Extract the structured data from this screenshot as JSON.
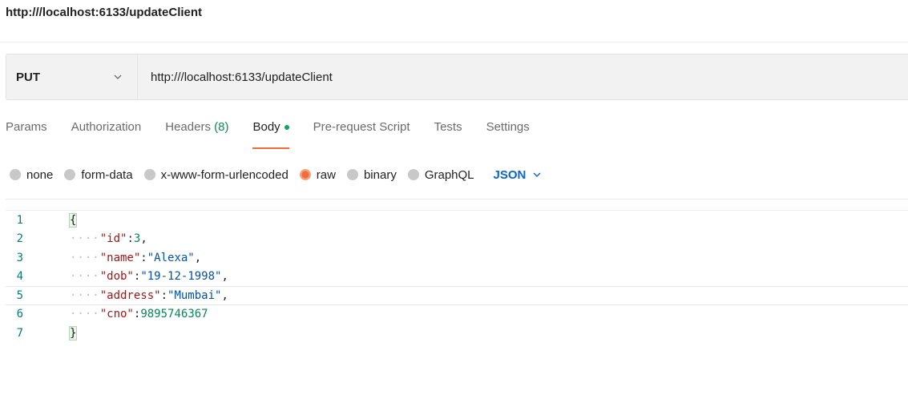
{
  "request": {
    "title": "http:///localhost:6133/updateClient",
    "method": "PUT",
    "url": "http:///localhost:6133/updateClient"
  },
  "tabs": [
    {
      "label": "Params"
    },
    {
      "label": "Authorization"
    },
    {
      "label": "Headers",
      "count": "(8)"
    },
    {
      "label": "Body",
      "active": true
    },
    {
      "label": "Pre-request Script"
    },
    {
      "label": "Tests"
    },
    {
      "label": "Settings"
    }
  ],
  "body_types": {
    "options": [
      "none",
      "form-data",
      "x-www-form-urlencoded",
      "raw",
      "binary",
      "GraphQL"
    ],
    "selected": "raw",
    "format": "JSON"
  },
  "editor": {
    "line_numbers": [
      "1",
      "2",
      "3",
      "4",
      "5",
      "6",
      "7"
    ],
    "open_brace": "{",
    "close_brace": "}",
    "entries": [
      {
        "key": "\"id\"",
        "value": "3",
        "comma": ","
      },
      {
        "key": "\"name\"",
        "value": "\"Alexa\"",
        "comma": ","
      },
      {
        "key": "\"dob\"",
        "value": "\"19-12-1998\"",
        "comma": ","
      },
      {
        "key": "\"address\"",
        "value": "\"Mumbai\"",
        "comma": ","
      },
      {
        "key": "\"cno\"",
        "value": "9895746367",
        "comma": ""
      }
    ],
    "indent_marker": "····",
    "colon": ":"
  },
  "colors": {
    "accent": "#f26b3a",
    "json_link": "#0a66cc",
    "headers_count": "#0c8a52"
  }
}
